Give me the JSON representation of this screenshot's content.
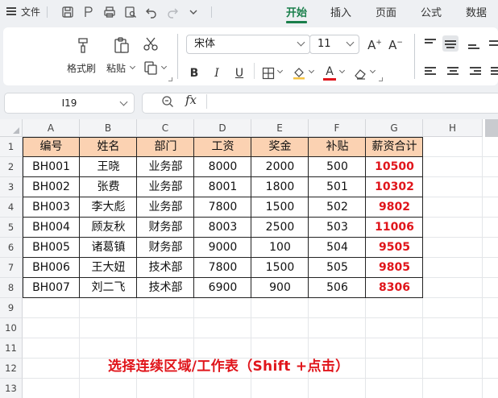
{
  "menu": {
    "file_label": "文件",
    "tabs": [
      "开始",
      "插入",
      "页面",
      "公式",
      "数据"
    ],
    "active_tab": "开始",
    "accent": "#1a7f4b"
  },
  "ribbon": {
    "format_painter_label": "格式刷",
    "paste_label": "粘贴",
    "font_name": "宋体",
    "font_size": "11",
    "bold": "B",
    "italic": "I",
    "underline": "U",
    "font_color": "#e0151b",
    "fill_color": "#f5c342"
  },
  "formula_bar": {
    "cell_ref": "I19",
    "fx_label": "fx",
    "formula": ""
  },
  "sheet": {
    "columns": [
      "A",
      "B",
      "C",
      "D",
      "E",
      "F",
      "G",
      "H"
    ],
    "rows": [
      "1",
      "2",
      "3",
      "4",
      "5",
      "6",
      "7",
      "8",
      "9",
      "10",
      "11",
      "12",
      "13"
    ],
    "header": [
      "编号",
      "姓名",
      "部门",
      "工资",
      "奖金",
      "补贴",
      "薪资合计"
    ],
    "data": [
      [
        "BH001",
        "王晓",
        "业务部",
        "8000",
        "2000",
        "500",
        "10500"
      ],
      [
        "BH002",
        "张费",
        "业务部",
        "8001",
        "1800",
        "501",
        "10302"
      ],
      [
        "BH003",
        "李大彪",
        "业务部",
        "7800",
        "1500",
        "502",
        "9802"
      ],
      [
        "BH004",
        "顾友秋",
        "财务部",
        "8003",
        "2500",
        "503",
        "11006"
      ],
      [
        "BH005",
        "诸葛镇",
        "财务部",
        "9000",
        "100",
        "504",
        "9505"
      ],
      [
        "BH006",
        "王大妞",
        "技术部",
        "7800",
        "1500",
        "505",
        "9805"
      ],
      [
        "BH007",
        "刘二飞",
        "技术部",
        "6900",
        "900",
        "506",
        "8306"
      ]
    ],
    "header_fill": "#fbd2b2",
    "total_color": "#e0151b"
  },
  "caption": "选择连续区域/工作表（Shift +点击）"
}
